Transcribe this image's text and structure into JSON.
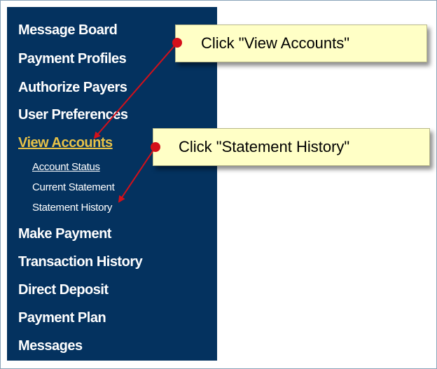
{
  "sidebar": {
    "items": [
      {
        "label": "Message Board"
      },
      {
        "label": "Payment Profiles"
      },
      {
        "label": "Authorize Payers"
      },
      {
        "label": "User Preferences"
      },
      {
        "label": "View Accounts"
      },
      {
        "label": "Make Payment"
      },
      {
        "label": "Transaction History"
      },
      {
        "label": "Direct Deposit"
      },
      {
        "label": "Payment Plan"
      },
      {
        "label": "Messages"
      }
    ],
    "subitems": [
      {
        "label": "Account Status"
      },
      {
        "label": "Current Statement"
      },
      {
        "label": "Statement History"
      }
    ],
    "colors": {
      "background": "#04325f",
      "text": "#ffffff",
      "active": "#e8c247"
    }
  },
  "callouts": [
    {
      "text": "Click \"View Accounts\""
    },
    {
      "text": "Click \"Statement History\""
    }
  ],
  "annotation_colors": {
    "arrow": "#d4101a",
    "callout_background": "#ffffc6"
  }
}
